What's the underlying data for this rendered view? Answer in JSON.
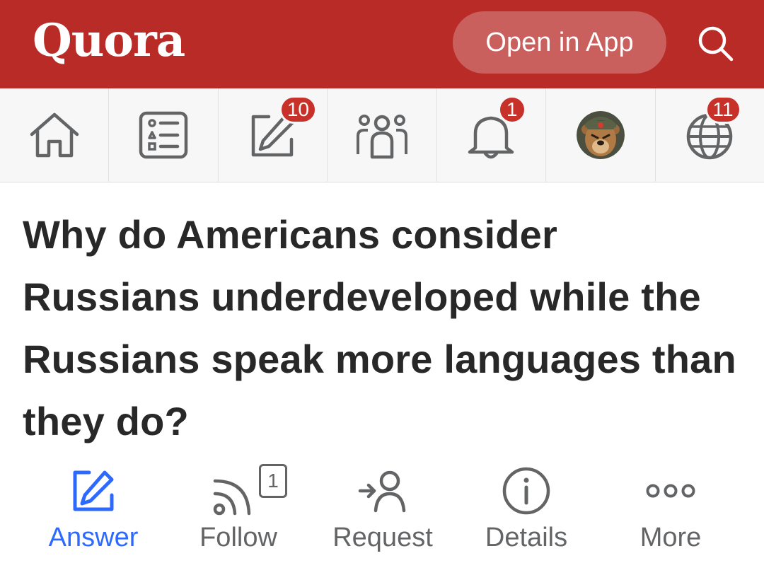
{
  "header": {
    "logo": "Quora",
    "open_app_label": "Open in App",
    "search_icon": "search-icon",
    "brand_color": "#b92b27"
  },
  "nav": {
    "items": [
      {
        "name": "home",
        "icon": "home-icon"
      },
      {
        "name": "following",
        "icon": "feed-list-icon"
      },
      {
        "name": "answer",
        "icon": "pencil-icon",
        "badge": "10"
      },
      {
        "name": "spaces",
        "icon": "people-icon"
      },
      {
        "name": "notifications",
        "icon": "bell-icon",
        "badge": "1"
      },
      {
        "name": "profile",
        "icon": "avatar"
      },
      {
        "name": "languages",
        "icon": "globe-icon",
        "badge": "11"
      }
    ],
    "badge_color": "#c8302a"
  },
  "question": {
    "title": "Why do Americans consider Russians underdeveloped while the Russians speak more languages than they do?"
  },
  "actions": {
    "answer": {
      "label": "Answer",
      "icon": "pencil-icon"
    },
    "follow": {
      "label": "Follow",
      "icon": "rss-icon",
      "count": "1"
    },
    "request": {
      "label": "Request",
      "icon": "request-person-icon"
    },
    "details": {
      "label": "Details",
      "icon": "info-icon"
    },
    "more": {
      "label": "More",
      "icon": "more-dots-icon"
    },
    "active_color": "#2e69ff"
  }
}
